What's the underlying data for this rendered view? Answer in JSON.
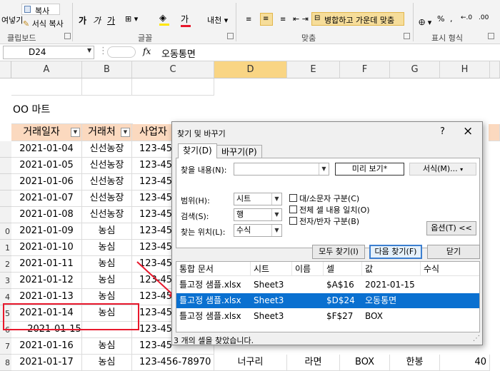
{
  "ribbon": {
    "paste_label": "여넣기",
    "copy_label": "복사",
    "format_copy_label": "서식 복사",
    "clipboard_group": "클립보드",
    "font_group": "글꼴",
    "align_group": "맞춤",
    "number_group": "표시 형식",
    "merge_label": "병합하고 가운데 맞춤",
    "wrap_label": "텍스트 줄 바꿈",
    "font_color_glyph": "가",
    "bold": "가",
    "italic": "가"
  },
  "formula_bar": {
    "cell_ref": "D24",
    "fx": "fx",
    "content": "오동통면"
  },
  "columns": [
    "A",
    "B",
    "C",
    "D",
    "E",
    "F",
    "G",
    "H"
  ],
  "sheet": {
    "title_cell": "OO 마트",
    "headers": [
      "거래일자",
      "거래처",
      "사업자"
    ],
    "rows": [
      {
        "row": "",
        "date": "2021-01-04",
        "vendor": "신선농장",
        "biz": "123-45"
      },
      {
        "row": "",
        "date": "2021-01-05",
        "vendor": "신선농장",
        "biz": "123-45"
      },
      {
        "row": "",
        "date": "2021-01-06",
        "vendor": "신선농장",
        "biz": "123-45"
      },
      {
        "row": "",
        "date": "2021-01-07",
        "vendor": "신선농장",
        "biz": "123-45"
      },
      {
        "row": "",
        "date": "2021-01-08",
        "vendor": "신선농장",
        "biz": "123-45"
      },
      {
        "row": "0",
        "date": "2021-01-09",
        "vendor": "농심",
        "biz": "123-45"
      },
      {
        "row": "1",
        "date": "2021-01-10",
        "vendor": "농심",
        "biz": "123-45"
      },
      {
        "row": "2",
        "date": "2021-01-11",
        "vendor": "농심",
        "biz": "123-45"
      },
      {
        "row": "3",
        "date": "2021-01-12",
        "vendor": "농심",
        "biz": "123-45"
      },
      {
        "row": "4",
        "date": "2021-01-13",
        "vendor": "농심",
        "biz": "123-45"
      },
      {
        "row": "5",
        "date": "2021-01-14",
        "vendor": "농심",
        "biz": "123-45"
      },
      {
        "row": "6",
        "date": "2021-01-15",
        "vendor": "",
        "biz": "123-45"
      },
      {
        "row": "7",
        "date": "2021-01-16",
        "vendor": "농심",
        "biz": "123-45"
      },
      {
        "row": "8",
        "date": "2021-01-17",
        "vendor": "농심",
        "biz": "123-456-78970",
        "d": "너구리",
        "e": "라면",
        "f": "BOX",
        "g": "한봉",
        "h": "40"
      }
    ]
  },
  "dialog": {
    "title": "찾기 및 바꾸기",
    "help": "?",
    "close": "×",
    "tab_find": "찾기(D)",
    "tab_replace": "바꾸기(P)",
    "find_label": "찾을 내용(N):",
    "find_value": "",
    "preview_label": "미리 보기*",
    "format_label": "서식(M)...",
    "scope_label": "범위(H):",
    "scope_value": "시트",
    "search_label": "검색(S):",
    "search_value": "행",
    "lookin_label": "찾는 위치(L):",
    "lookin_value": "수식",
    "match_case": "대/소문자 구분(C)",
    "match_entire": "전체 셀 내용 일치(O)",
    "match_byte": "전자/반자 구분(B)",
    "options_label": "옵션(T) <<",
    "find_all": "모두 찾기(I)",
    "find_next": "다음 찾기(F)",
    "close_btn": "닫기",
    "result_headers": [
      "통합 문서",
      "시트",
      "이름",
      "셀",
      "값",
      "수식"
    ],
    "results": [
      {
        "book": "틀고정 샘플.xlsx",
        "sheet": "Sheet3",
        "name": "",
        "cell": "$A$16",
        "value": "2021-01-15",
        "formula": ""
      },
      {
        "book": "틀고정 샘플.xlsx",
        "sheet": "Sheet3",
        "name": "",
        "cell": "$D$24",
        "value": "오동통면",
        "formula": ""
      },
      {
        "book": "틀고정 샘플.xlsx",
        "sheet": "Sheet3",
        "name": "",
        "cell": "$F$27",
        "value": "BOX",
        "formula": ""
      }
    ],
    "status": "3 개의 셀을 찾았습니다."
  },
  "colors": {
    "accent_selected": "#0a70d0",
    "header_fill": "#fbd9bf",
    "highlight": "#e8182c",
    "selected_column": "#f9d584"
  }
}
